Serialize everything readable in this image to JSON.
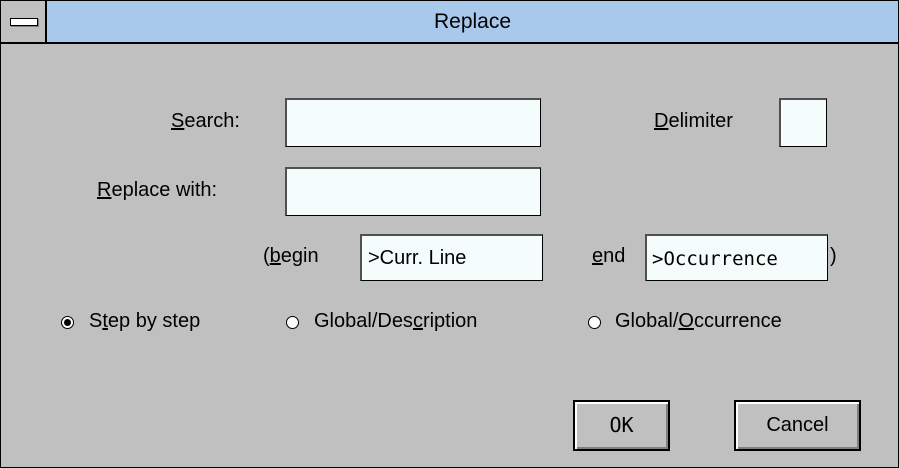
{
  "window": {
    "title": "Replace"
  },
  "form": {
    "search_label_pre": "",
    "search_label_u": "S",
    "search_label_post": "earch:",
    "search_value": "",
    "replace_label_u": "R",
    "replace_label_post": "eplace with:",
    "replace_value": "",
    "delimiter_label_u": "D",
    "delimiter_label_post": "elimiter",
    "delimiter_value": "",
    "begin_label_pre": "(",
    "begin_label_u": "b",
    "begin_label_post": "egin",
    "begin_value": ">Curr. Line",
    "end_label_u": "e",
    "end_label_post": "nd",
    "end_value": ">Occurrence",
    "end_close": ")"
  },
  "mode": {
    "selected": "step",
    "step_pre": "S",
    "step_u": "t",
    "step_post": "ep by step",
    "global_desc_pre": "Global/Des",
    "global_desc_u": "c",
    "global_desc_post": "ription",
    "global_occ_pre": "Global/",
    "global_occ_u": "O",
    "global_occ_post": "ccurrence"
  },
  "buttons": {
    "ok": "OK",
    "cancel": "Cancel"
  }
}
